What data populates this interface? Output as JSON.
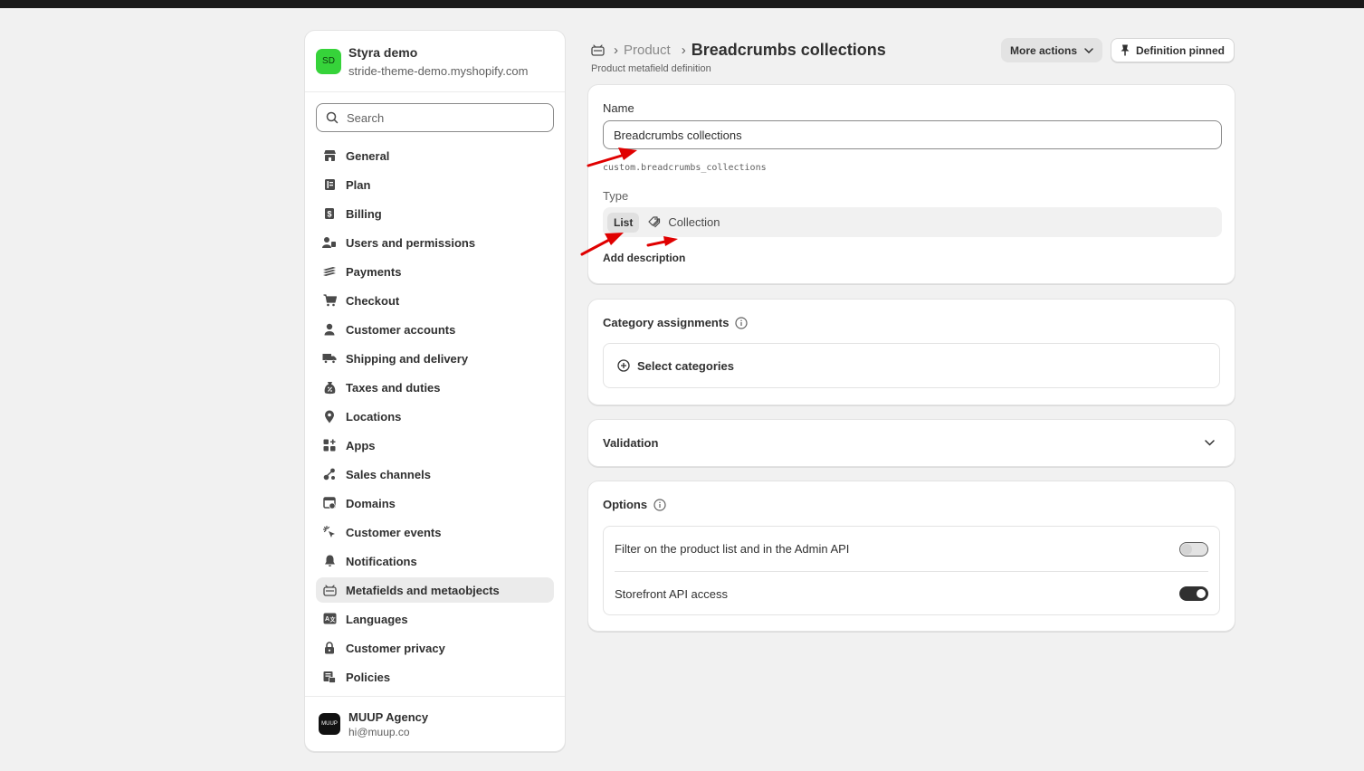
{
  "store": {
    "avatar": "SD",
    "name": "Styra demo",
    "url": "stride-theme-demo.myshopify.com",
    "avatar_color": "#36d33a"
  },
  "search": {
    "placeholder": "Search"
  },
  "nav": [
    {
      "label": "General",
      "icon": "store-icon"
    },
    {
      "label": "Plan",
      "icon": "plan-icon"
    },
    {
      "label": "Billing",
      "icon": "billing-icon"
    },
    {
      "label": "Users and permissions",
      "icon": "users-icon"
    },
    {
      "label": "Payments",
      "icon": "payments-icon"
    },
    {
      "label": "Checkout",
      "icon": "cart-icon"
    },
    {
      "label": "Customer accounts",
      "icon": "person-icon"
    },
    {
      "label": "Shipping and delivery",
      "icon": "truck-icon"
    },
    {
      "label": "Taxes and duties",
      "icon": "tax-icon"
    },
    {
      "label": "Locations",
      "icon": "location-icon"
    },
    {
      "label": "Apps",
      "icon": "apps-icon"
    },
    {
      "label": "Sales channels",
      "icon": "channels-icon"
    },
    {
      "label": "Domains",
      "icon": "domains-icon"
    },
    {
      "label": "Customer events",
      "icon": "cursor-icon"
    },
    {
      "label": "Notifications",
      "icon": "bell-icon"
    },
    {
      "label": "Metafields and metaobjects",
      "icon": "metafields-icon",
      "active": true
    },
    {
      "label": "Languages",
      "icon": "language-icon"
    },
    {
      "label": "Customer privacy",
      "icon": "lock-icon"
    },
    {
      "label": "Policies",
      "icon": "policy-icon"
    }
  ],
  "account": {
    "avatar": "MUUP",
    "name": "MUUP Agency",
    "email": "hi@muup.co"
  },
  "header": {
    "crumb": "Product",
    "title": "Breadcrumbs collections",
    "subtitle": "Product metafield definition",
    "more_actions": "More actions",
    "pinned": "Definition pinned"
  },
  "definition": {
    "name_label": "Name",
    "name_value": "Breadcrumbs collections",
    "key": "custom.breadcrumbs_collections",
    "type_label": "Type",
    "type_list": "List",
    "type_value": "Collection",
    "add_description": "Add description"
  },
  "categories": {
    "title": "Category assignments",
    "select": "Select categories"
  },
  "validation": {
    "title": "Validation"
  },
  "options": {
    "title": "Options",
    "items": [
      {
        "label": "Filter on the product list and in the Admin API",
        "enabled": false
      },
      {
        "label": "Storefront API access",
        "enabled": true
      }
    ]
  },
  "colors": {
    "annotation": "#e00000",
    "background": "#f1f1f1",
    "toggle_on": "#303030"
  }
}
